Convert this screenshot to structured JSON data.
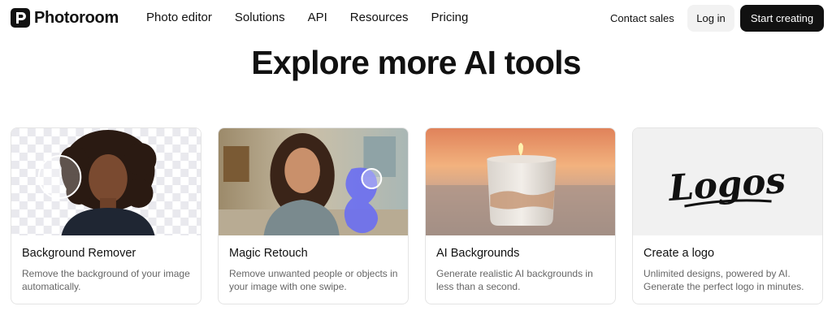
{
  "brand": {
    "name": "Photoroom"
  },
  "nav": {
    "links": [
      "Photo editor",
      "Solutions",
      "API",
      "Resources",
      "Pricing"
    ],
    "contact_label": "Contact sales",
    "login_label": "Log in",
    "cta_label": "Start creating"
  },
  "section": {
    "heading": "Explore more AI tools"
  },
  "cards": [
    {
      "title": "Background Remover",
      "desc": "Remove the background of your image automatically."
    },
    {
      "title": "Magic Retouch",
      "desc": "Remove unwanted people or objects in your image with one swipe."
    },
    {
      "title": "AI Backgrounds",
      "desc": "Generate realistic AI backgrounds in less than a second."
    },
    {
      "title": "Create a logo",
      "desc": "Unlimited designs, powered by AI. Generate the perfect logo in minutes.",
      "logo_text": "Logos"
    }
  ],
  "colors": {
    "text": "#111111",
    "muted": "#666666",
    "cta_bg": "#111111",
    "login_bg": "#f2f2f2",
    "border": "#e4e4e4"
  }
}
